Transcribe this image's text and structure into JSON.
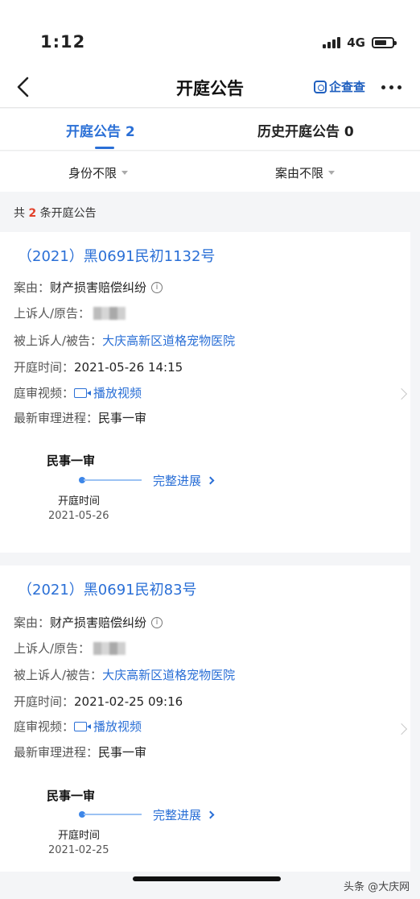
{
  "status": {
    "time": "1:12",
    "network": "4G"
  },
  "nav": {
    "title": "开庭公告",
    "brand": "企查查"
  },
  "tabs": {
    "active": "开庭公告 2",
    "history": "历史开庭公告 0"
  },
  "filters": {
    "identity": "身份不限",
    "cause": "案由不限"
  },
  "summary": {
    "prefix": "共 ",
    "count": "2",
    "suffix": " 条开庭公告"
  },
  "cases": [
    {
      "case_no": "（2021）黑0691民初1132号",
      "cause_label": "案由：",
      "cause_value": "财产损害赔偿纠纷",
      "plaintiff_label": "上诉人/原告：",
      "defendant_label": "被上诉人/被告：",
      "defendant_value": "大庆高新区道格宠物医院",
      "time_label": "开庭时间：",
      "time_value": "2021-05-26 14:15",
      "video_label": "庭审视频：",
      "video_link": "播放视频",
      "progress_label": "最新审理进程：",
      "progress_value": "民事一审",
      "timeline": {
        "stage": "民事一审",
        "link": "完整进展",
        "sublabel": "开庭时间",
        "date": "2021-05-26"
      }
    },
    {
      "case_no": "（2021）黑0691民初83号",
      "cause_label": "案由：",
      "cause_value": "财产损害赔偿纠纷",
      "plaintiff_label": "上诉人/原告：",
      "defendant_label": "被上诉人/被告：",
      "defendant_value": "大庆高新区道格宠物医院",
      "time_label": "开庭时间：",
      "time_value": "2021-02-25 09:16",
      "video_label": "庭审视频：",
      "video_link": "播放视频",
      "progress_label": "最新审理进程：",
      "progress_value": "民事一审",
      "timeline": {
        "stage": "民事一审",
        "link": "完整进展",
        "sublabel": "开庭时间",
        "date": "2021-02-25"
      }
    }
  ],
  "watermark": "头条 @大庆网",
  "colors": {
    "accent": "#2a6fd6",
    "count_red": "#e2412b",
    "background": "#f4f5f7"
  }
}
